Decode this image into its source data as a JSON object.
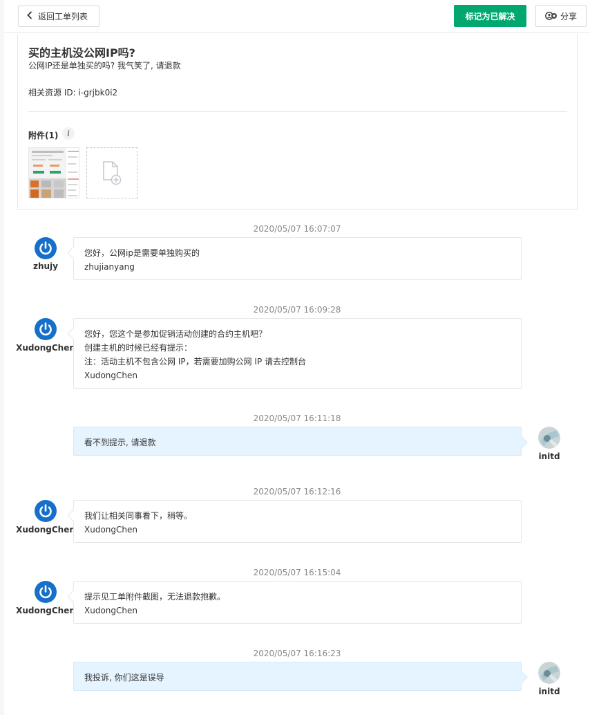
{
  "topbar": {
    "back_label": "返回工单列表",
    "resolve_label": "标记为已解决",
    "share_label": "分享"
  },
  "ticket": {
    "title": "买的主机没公网IP吗?",
    "description": "公网IP还是单独买的吗? 我气笑了, 请退款",
    "resource_id": "相关资源 ID: i-grjbk0i2",
    "attachments_label": "附件(1)",
    "info_icon_glyph": "i"
  },
  "messages": [
    {
      "time": "2020/05/07 16:07:07",
      "user": "zhujy",
      "side": "staff",
      "lines": [
        "您好，公网ip是需要单独购买的",
        "zhujianyang"
      ]
    },
    {
      "time": "2020/05/07 16:09:28",
      "user": "XudongChen",
      "side": "staff",
      "lines": [
        "您好，您这个是参加促销活动创建的合约主机吧？",
        "创建主机的时候已经有提示：",
        "注：活动主机不包含公网 IP，若需要加购公网 IP 请去控制台",
        "XudongChen"
      ]
    },
    {
      "time": "2020/05/07 16:11:18",
      "user": "initd",
      "side": "user",
      "lines": [
        "看不到提示, 请退款"
      ]
    },
    {
      "time": "2020/05/07 16:12:16",
      "user": "XudongChen",
      "side": "staff",
      "lines": [
        "我们让相关同事看下，稍等。",
        "XudongChen"
      ]
    },
    {
      "time": "2020/05/07 16:15:04",
      "user": "XudongChen",
      "side": "staff",
      "lines": [
        "提示见工单附件截图，无法退款抱歉。",
        "XudongChen"
      ]
    },
    {
      "time": "2020/05/07 16:16:23",
      "user": "initd",
      "side": "user",
      "lines": [
        "我投诉, 你们这是误导"
      ]
    }
  ],
  "colors": {
    "accent_green": "#00a870",
    "staff_avatar_blue": "#1670c9",
    "user_bubble_bg": "#e6f4ff"
  }
}
